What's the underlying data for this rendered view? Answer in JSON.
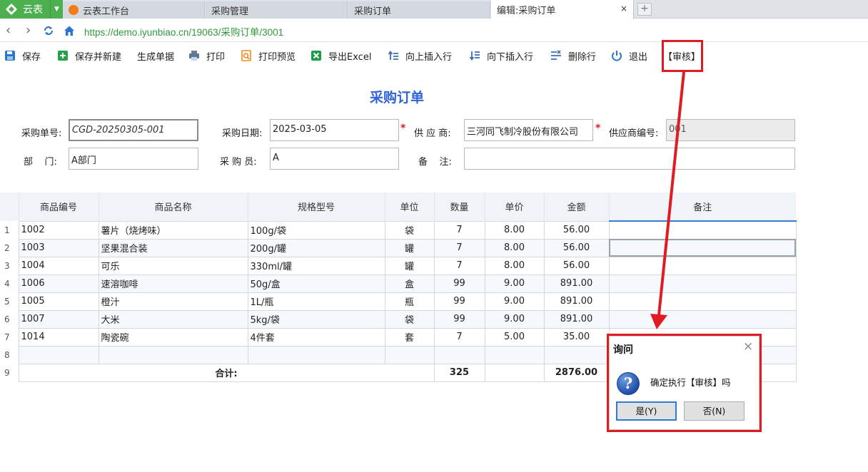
{
  "app": {
    "name": "云表"
  },
  "tabs": [
    {
      "label": "云表工作台"
    },
    {
      "label": "采购管理"
    },
    {
      "label": "采购订单"
    },
    {
      "label": "编辑:采购订单",
      "close": "×"
    }
  ],
  "newtab": "+",
  "address": {
    "url": "https://demo.iyunbiao.cn/19063/采购订单/3001"
  },
  "toolbar": {
    "save": "保存",
    "save_new": "保存并新建",
    "generate": "生成单据",
    "print": "打印",
    "print_preview": "打印预览",
    "export_excel": "导出Excel",
    "insert_above": "向上插入行",
    "insert_below": "向下插入行",
    "delete_row": "删除行",
    "exit": "退出",
    "audit": "【审核】"
  },
  "page_title": "采购订单",
  "form": {
    "order_no": {
      "label": "采购单号:",
      "value": "CGD-20250305-001"
    },
    "order_date": {
      "label": "采购日期:",
      "value": "2025-03-05"
    },
    "supplier": {
      "label": "供 应 商:",
      "value": "三河同飞制冷股份有限公司"
    },
    "supplier_code": {
      "label": "供应商编号:",
      "value": "001"
    },
    "department": {
      "label": "部    门:",
      "value": "A部门"
    },
    "buyer": {
      "label": "采 购 员:",
      "value": "A"
    },
    "remark": {
      "label": "备    注:",
      "value": ""
    },
    "required_mark": "*"
  },
  "grid": {
    "headers": [
      "商品编号",
      "商品名称",
      "规格型号",
      "单位",
      "数量",
      "单价",
      "金额",
      "备注"
    ],
    "rows": [
      {
        "n": "1",
        "code": "1002",
        "name": "薯片（烧烤味）",
        "spec": "100g/袋",
        "unit": "袋",
        "qty": "7",
        "price": "8.00",
        "amount": "56.00",
        "remark": ""
      },
      {
        "n": "2",
        "code": "1003",
        "name": "坚果混合装",
        "spec": "200g/罐",
        "unit": "罐",
        "qty": "7",
        "price": "8.00",
        "amount": "56.00",
        "remark": ""
      },
      {
        "n": "3",
        "code": "1004",
        "name": "可乐",
        "spec": "330ml/罐",
        "unit": "罐",
        "qty": "7",
        "price": "8.00",
        "amount": "56.00",
        "remark": ""
      },
      {
        "n": "4",
        "code": "1006",
        "name": "速溶咖啡",
        "spec": "50g/盒",
        "unit": "盒",
        "qty": "99",
        "price": "9.00",
        "amount": "891.00",
        "remark": ""
      },
      {
        "n": "5",
        "code": "1005",
        "name": "橙汁",
        "spec": "1L/瓶",
        "unit": "瓶",
        "qty": "99",
        "price": "9.00",
        "amount": "891.00",
        "remark": ""
      },
      {
        "n": "6",
        "code": "1007",
        "name": "大米",
        "spec": "5kg/袋",
        "unit": "袋",
        "qty": "99",
        "price": "9.00",
        "amount": "891.00",
        "remark": ""
      },
      {
        "n": "7",
        "code": "1014",
        "name": "陶瓷碗",
        "spec": "4件套",
        "unit": "套",
        "qty": "7",
        "price": "5.00",
        "amount": "35.00",
        "remark": ""
      }
    ],
    "empty_row_n": "8",
    "total": {
      "n": "9",
      "label": "合计:",
      "qty": "325",
      "amount": "2876.00"
    }
  },
  "dialog": {
    "title": "询问",
    "close": "×",
    "icon": "?",
    "message": "确定执行【审核】吗",
    "yes": "是(Y)",
    "no": "否(N)"
  },
  "colors": {
    "accent_red": "#e01b24",
    "title_blue": "#2f63d8",
    "app_green": "#4caf50",
    "url_green": "#2e9a3a"
  }
}
